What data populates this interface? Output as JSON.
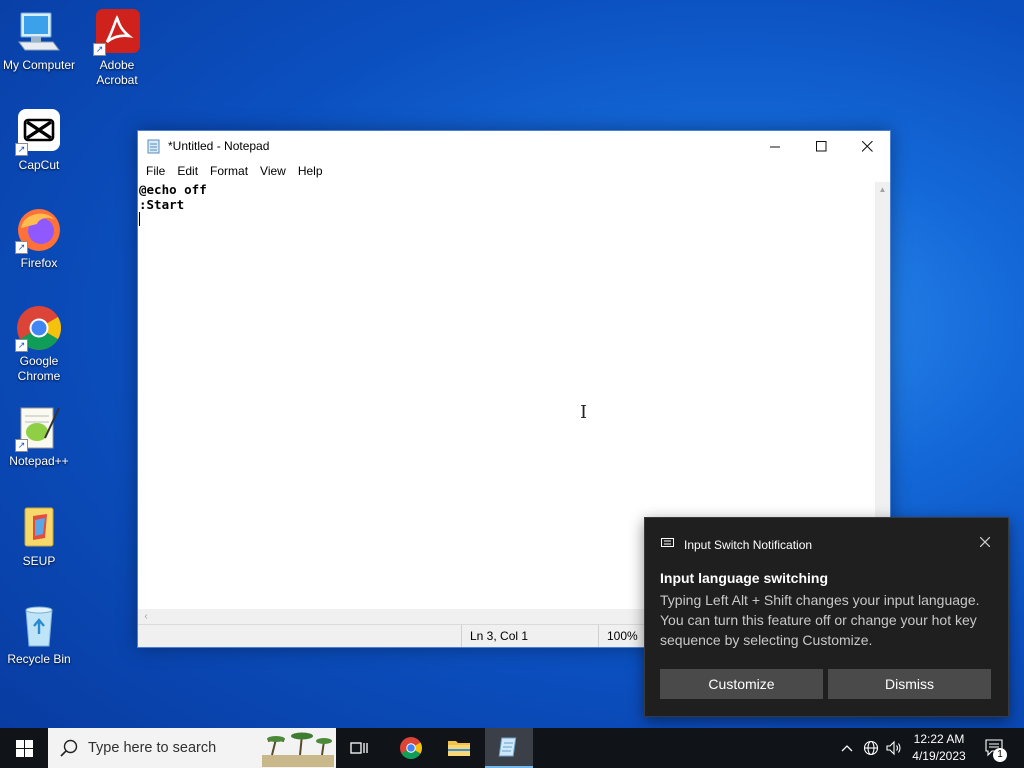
{
  "desktop": {
    "icons": [
      {
        "label": "My Computer"
      },
      {
        "label": "Adobe Acrobat"
      },
      {
        "label": "CapCut"
      },
      {
        "label": "Firefox"
      },
      {
        "label": "Google Chrome"
      },
      {
        "label": "Notepad++"
      },
      {
        "label": "SEUP"
      },
      {
        "label": "Recycle Bin"
      }
    ]
  },
  "notepad": {
    "title": "*Untitled - Notepad",
    "menu": [
      "File",
      "Edit",
      "Format",
      "View",
      "Help"
    ],
    "content_lines": [
      "@echo off",
      ":Start",
      ""
    ],
    "status": {
      "position": "Ln 3, Col 1",
      "zoom": "100%"
    },
    "controls": {
      "minimize": "—",
      "maximize": "☐",
      "close": "✕"
    }
  },
  "toast": {
    "app_name": "Input Switch Notification",
    "heading": "Input language switching",
    "body": "Typing Left Alt + Shift changes your input language. You can turn this feature off or change your hot key sequence by selecting Customize.",
    "buttons": {
      "customize": "Customize",
      "dismiss": "Dismiss"
    }
  },
  "taskbar": {
    "search_placeholder": "Type here to search",
    "clock": {
      "time": "12:22 AM",
      "date": "4/19/2023"
    },
    "notification_count": "1",
    "pinned": [
      "task-view-icon",
      "chrome-icon",
      "file-explorer-icon",
      "notepad-icon"
    ]
  },
  "colors": {
    "desktop_bg": "#0b4fbf",
    "toast_bg": "#1f1f1f",
    "taskbar_bg": "#101318",
    "active_underline": "#76b9ed"
  }
}
